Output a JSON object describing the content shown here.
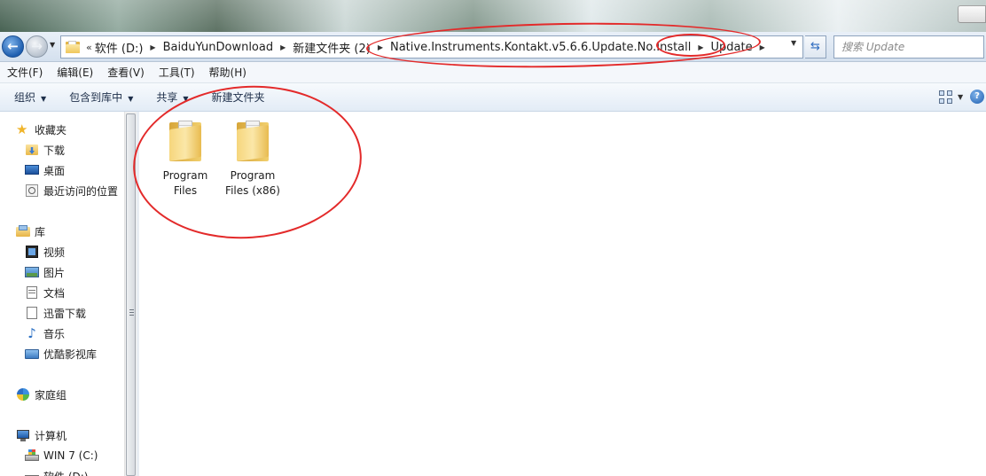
{
  "address_bar": {
    "overflow_glyph": "«",
    "crumbs": [
      "软件 (D:)",
      "BaiduYunDownload",
      "新建文件夹 (2)",
      "Native.Instruments.Kontakt.v5.6.6.Update.No.Install",
      "Update"
    ],
    "search_placeholder": "搜索 Update"
  },
  "menu_bar": {
    "items": [
      "文件(F)",
      "编辑(E)",
      "查看(V)",
      "工具(T)",
      "帮助(H)"
    ]
  },
  "command_bar": {
    "organize": "组织",
    "include_in_library": "包含到库中",
    "share": "共享",
    "new_folder": "新建文件夹"
  },
  "nav_pane": {
    "favorites": {
      "label": "收藏夹",
      "items": [
        "下载",
        "桌面",
        "最近访问的位置"
      ]
    },
    "libraries": {
      "label": "库",
      "items": [
        "视频",
        "图片",
        "文档",
        "迅雷下载",
        "音乐",
        "优酷影视库"
      ]
    },
    "homegroup": "家庭组",
    "computer": {
      "label": "计算机",
      "items": [
        "WIN 7 (C:)",
        "软件 (D:)"
      ]
    }
  },
  "content": {
    "folders": [
      {
        "line1": "Program",
        "line2": "Files"
      },
      {
        "line1": "Program",
        "line2": "Files (x86)"
      }
    ]
  },
  "colors": {
    "annotation": "#e32a2a",
    "accent": "#1f5fb0"
  }
}
